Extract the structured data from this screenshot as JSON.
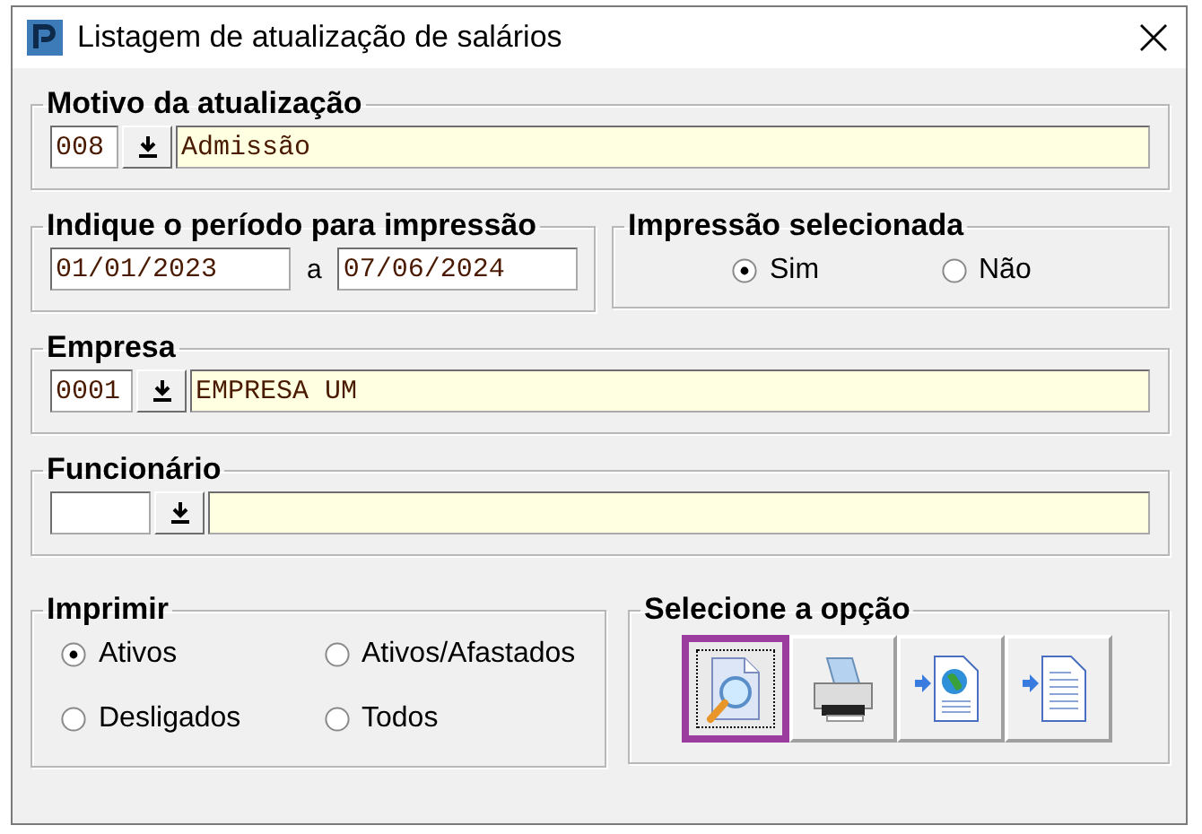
{
  "window": {
    "title": "Listagem de atualização de salários"
  },
  "motivo": {
    "legend": "Motivo da atualização",
    "code": "008",
    "value": "Admissão"
  },
  "periodo": {
    "legend": "Indique o período para impressão",
    "start": "01/01/2023",
    "separator": "a",
    "end": "07/06/2024"
  },
  "impressao": {
    "legend": "Impressão selecionada",
    "options": [
      {
        "label": "Sim",
        "selected": true
      },
      {
        "label": "Não",
        "selected": false
      }
    ]
  },
  "empresa": {
    "legend": "Empresa",
    "code": "0001",
    "value": "EMPRESA UM"
  },
  "funcionario": {
    "legend": "Funcionário"
  },
  "imprimir": {
    "legend": "Imprimir",
    "options": [
      {
        "label": "Ativos",
        "selected": true
      },
      {
        "label": "Ativos/Afastados",
        "selected": false
      },
      {
        "label": "Desligados",
        "selected": false
      },
      {
        "label": "Todos",
        "selected": false
      }
    ]
  },
  "opcao": {
    "legend": "Selecione a opção",
    "buttons": [
      {
        "kind": "preview",
        "selected": true
      },
      {
        "kind": "print",
        "selected": false
      },
      {
        "kind": "web",
        "selected": false
      },
      {
        "kind": "document",
        "selected": false
      }
    ]
  }
}
